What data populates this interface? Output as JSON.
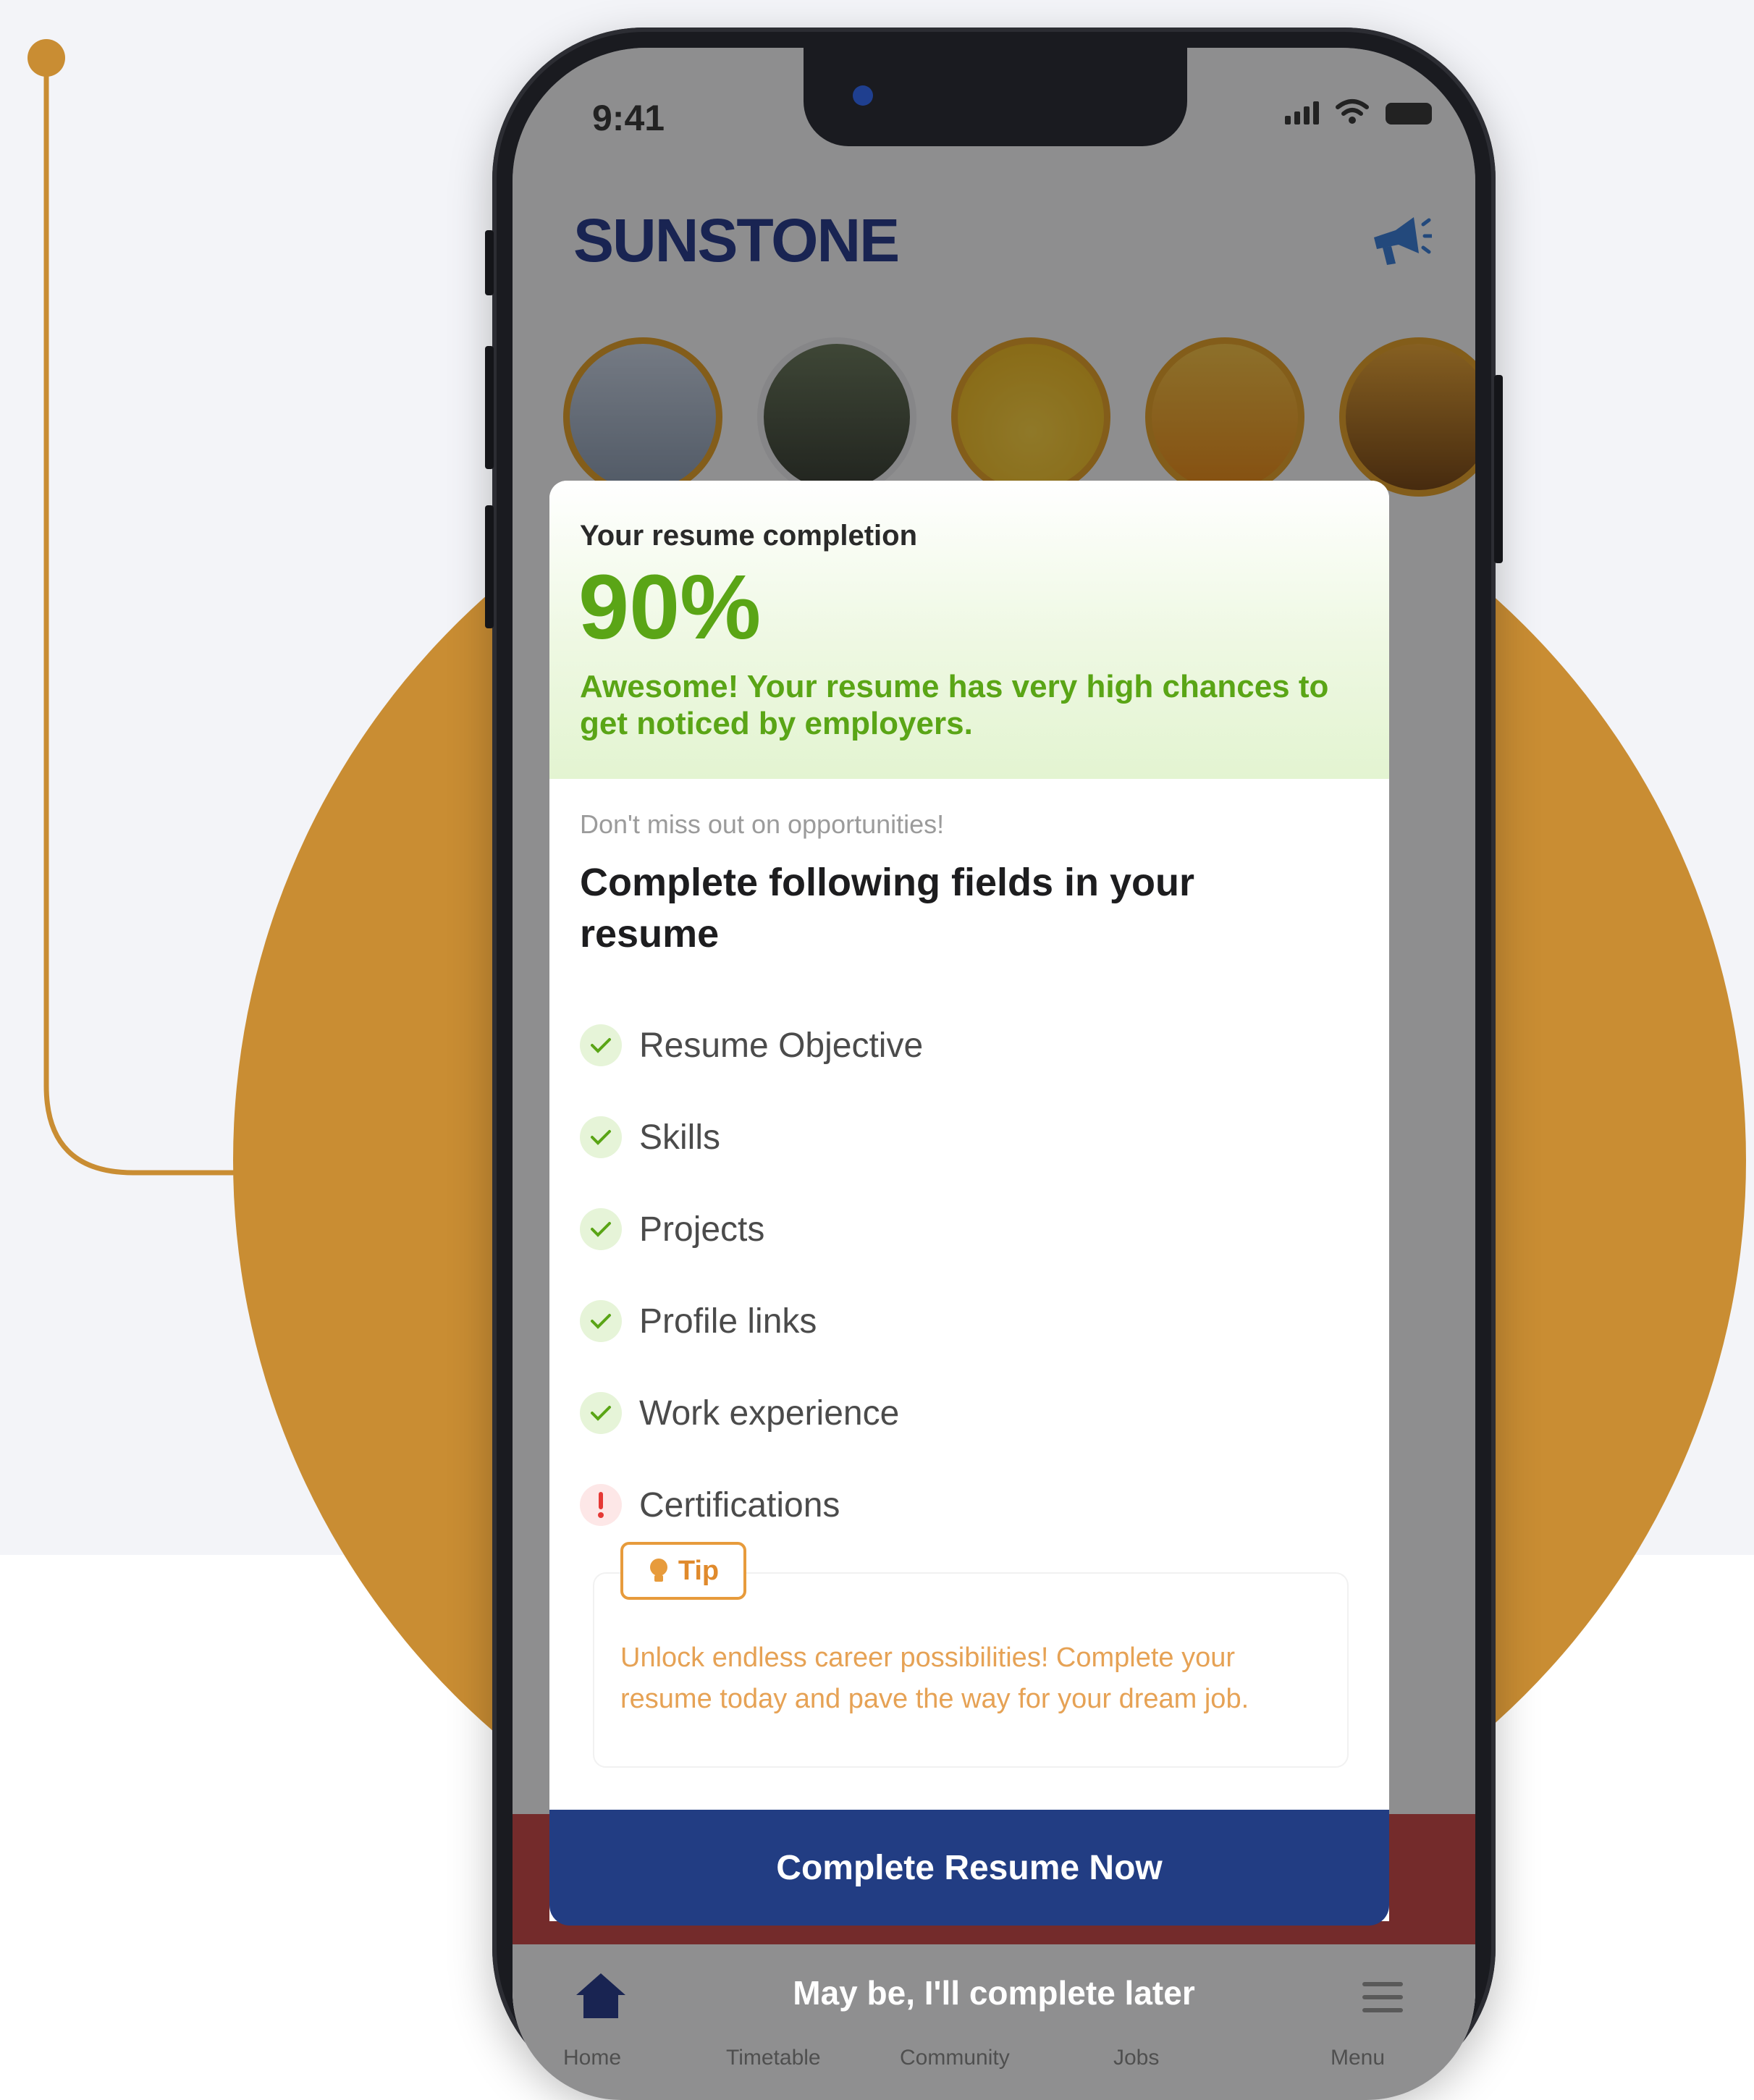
{
  "status_bar": {
    "time": "9:41"
  },
  "app": {
    "logo": "SUNSTONE"
  },
  "modal": {
    "completion_label": "Your resume completion",
    "completion_percent": "90%",
    "completion_value": 90,
    "completion_message": "Awesome! Your resume has very high chances to get noticed by employers.",
    "sub_label": "Don't miss out on opportunities!",
    "heading": "Complete following fields in your resume",
    "fields": [
      {
        "label": "Resume Objective",
        "status": "complete"
      },
      {
        "label": "Skills",
        "status": "complete"
      },
      {
        "label": "Projects",
        "status": "complete"
      },
      {
        "label": "Profile links",
        "status": "complete"
      },
      {
        "label": "Work experience",
        "status": "complete"
      },
      {
        "label": "Certifications",
        "status": "incomplete"
      }
    ],
    "tip": {
      "badge": "Tip",
      "text": "Unlock endless career possibilities! Complete your resume today and pave the way for your dream job."
    },
    "cta_label": "Complete Resume Now",
    "later_label": "May be, I'll complete later"
  },
  "tabbar": {
    "items": [
      "Home",
      "Timetable",
      "Community",
      "Jobs",
      "Menu"
    ]
  },
  "colors": {
    "accent_green": "#5aa516",
    "cta_blue": "#223d83",
    "decor_circle": "#c98d33",
    "tip_orange": "#e79b3c"
  }
}
